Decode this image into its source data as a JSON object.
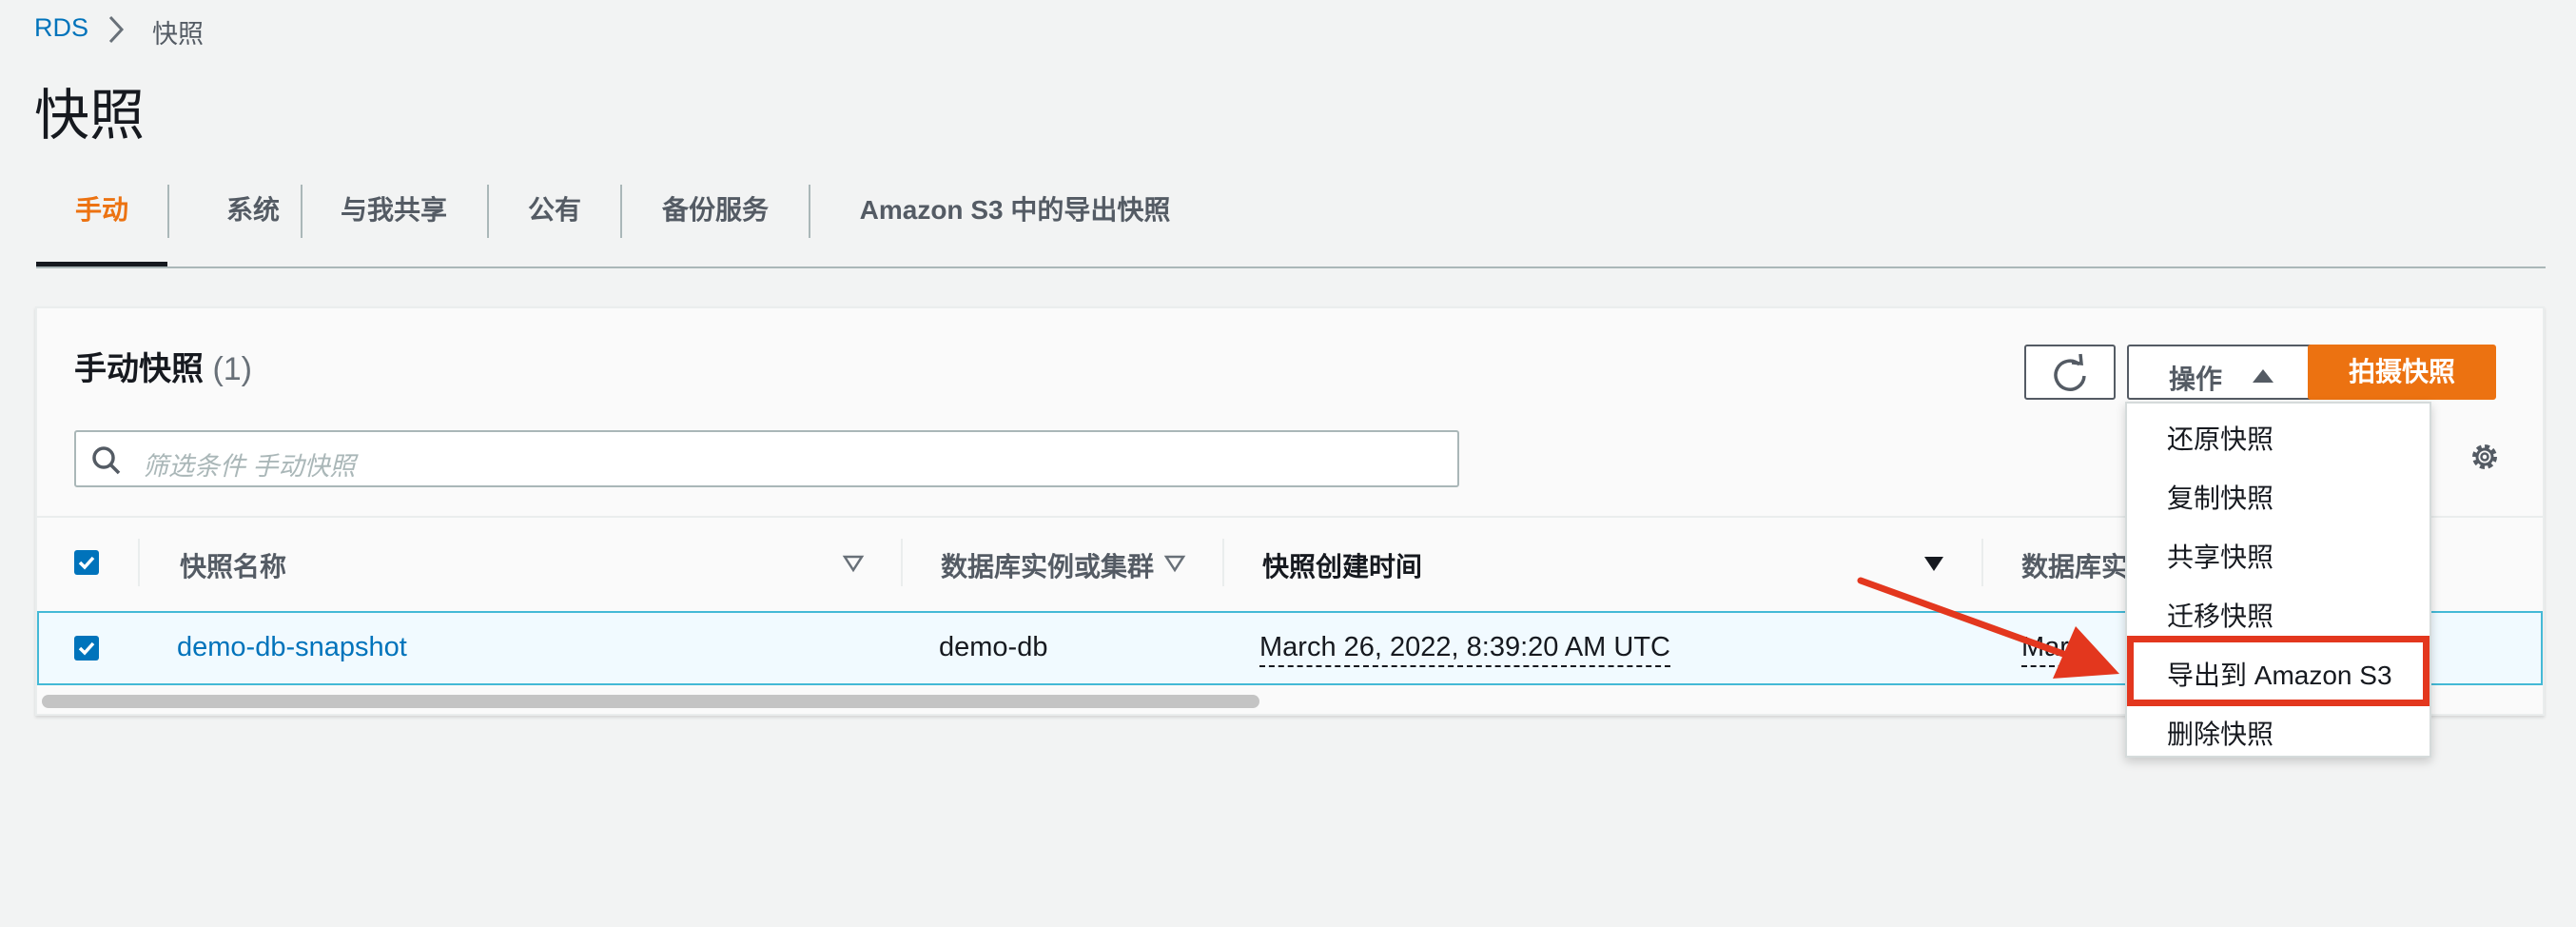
{
  "breadcrumb": {
    "root": "RDS",
    "current": "快照"
  },
  "page": {
    "title": "快照"
  },
  "tabs": [
    "手动",
    "系统",
    "与我共享",
    "公有",
    "备份服务",
    "Amazon S3 中的导出快照"
  ],
  "panel": {
    "title": "手动快照",
    "count": "(1)",
    "actions_label": "操作",
    "take_snapshot_label": "拍摄快照",
    "search_placeholder": "筛选条件 手动快照"
  },
  "table": {
    "headers": [
      "快照名称",
      "数据库实例或集群",
      "快照创建时间",
      "数据库实"
    ],
    "rows": [
      {
        "name": "demo-db-snapshot",
        "instance": "demo-db",
        "created": "March 26, 2022, 8:39:20 AM UTC",
        "partial": "Marc"
      }
    ]
  },
  "actions_menu": [
    "还原快照",
    "复制快照",
    "共享快照",
    "迁移快照",
    "导出到 Amazon S3",
    "删除快照"
  ],
  "colors": {
    "accent": "#ec7211",
    "link": "#0073bb",
    "annotation": "#e3371e"
  }
}
